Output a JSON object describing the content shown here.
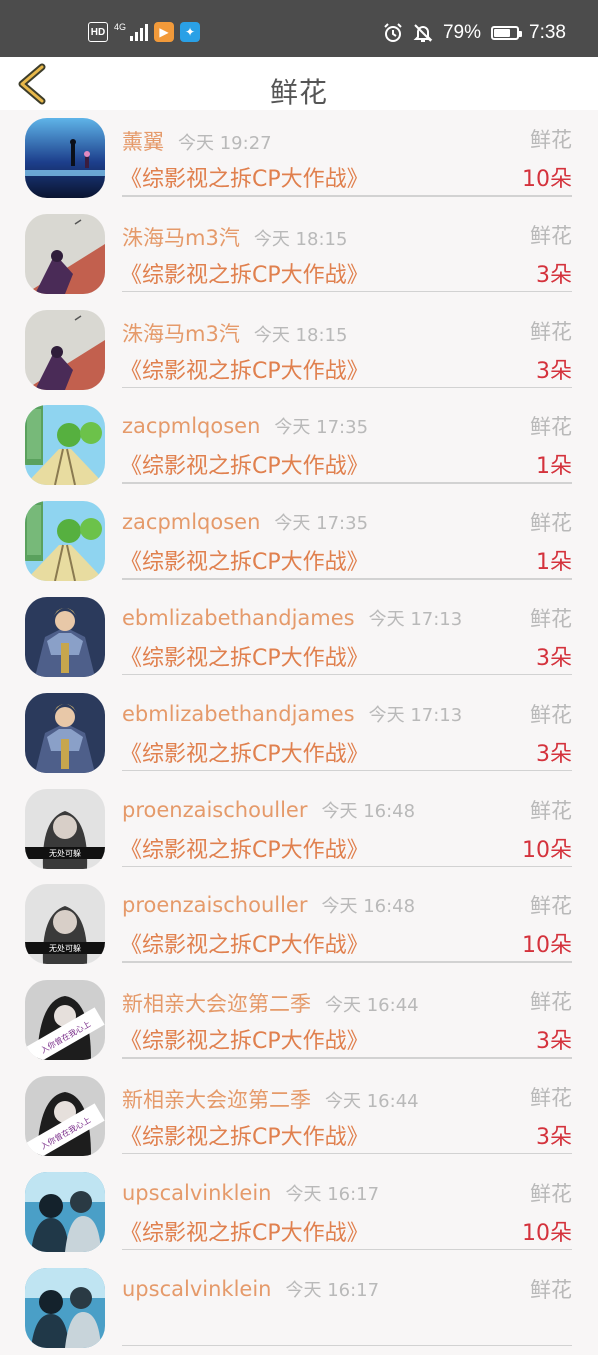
{
  "status_bar": {
    "hd": "HD",
    "network": "4G",
    "battery": "79%",
    "time": "7:38",
    "battery_level": 0.79
  },
  "header": {
    "title": "鲜花"
  },
  "records": [
    {
      "user": "薰翼",
      "time": "今天 19:27",
      "gift": "鲜花",
      "show": "《综影视之拆CP大作战》",
      "count": "10朵",
      "avatar": "night-figures-avatar"
    },
    {
      "user": "洙海马m3汽",
      "time": "今天 18:15",
      "gift": "鲜花",
      "show": "《综影视之拆CP大作战》",
      "count": "3朵",
      "avatar": "anime-couple-avatar"
    },
    {
      "user": "洙海马m3汽",
      "time": "今天 18:15",
      "gift": "鲜花",
      "show": "《综影视之拆CP大作战》",
      "count": "3朵",
      "avatar": "anime-couple-avatar"
    },
    {
      "user": "zacpmlqosen",
      "time": "今天 17:35",
      "gift": "鲜花",
      "show": "《综影视之拆CP大作战》",
      "count": "1朵",
      "avatar": "railway-scene-avatar"
    },
    {
      "user": "zacpmlqosen",
      "time": "今天 17:35",
      "gift": "鲜花",
      "show": "《综影视之拆CP大作战》",
      "count": "1朵",
      "avatar": "railway-scene-avatar"
    },
    {
      "user": "ebmlizabethandjames",
      "time": "今天 17:13",
      "gift": "鲜花",
      "show": "《综影视之拆CP大作战》",
      "count": "3朵",
      "avatar": "armored-warrior-avatar"
    },
    {
      "user": "ebmlizabethandjames",
      "time": "今天 17:13",
      "gift": "鲜花",
      "show": "《综影视之拆CP大作战》",
      "count": "3朵",
      "avatar": "armored-warrior-avatar"
    },
    {
      "user": "proenzaischouller",
      "time": "今天 16:48",
      "gift": "鲜花",
      "show": "《综影视之拆CP大作战》",
      "count": "10朵",
      "avatar": "girl-portrait-avatar"
    },
    {
      "user": "proenzaischouller",
      "time": "今天 16:48",
      "gift": "鲜花",
      "show": "《综影视之拆CP大作战》",
      "count": "10朵",
      "avatar": "girl-portrait-avatar"
    },
    {
      "user": "新相亲大会迩第二季",
      "time": "今天 16:44",
      "gift": "鲜花",
      "show": "《综影视之拆CP大作战》",
      "count": "3朵",
      "avatar": "bw-girl-avatar"
    },
    {
      "user": "新相亲大会迩第二季",
      "time": "今天 16:44",
      "gift": "鲜花",
      "show": "《综影视之拆CP大作战》",
      "count": "3朵",
      "avatar": "bw-girl-avatar"
    },
    {
      "user": "upscalvinklein",
      "time": "今天 16:17",
      "gift": "鲜花",
      "show": "《综影视之拆CP大作战》",
      "count": "10朵",
      "avatar": "two-people-avatar"
    },
    {
      "user": "upscalvinklein",
      "time": "今天 16:17",
      "gift": "鲜花",
      "show": "",
      "count": "",
      "avatar": "two-people-avatar"
    }
  ]
}
